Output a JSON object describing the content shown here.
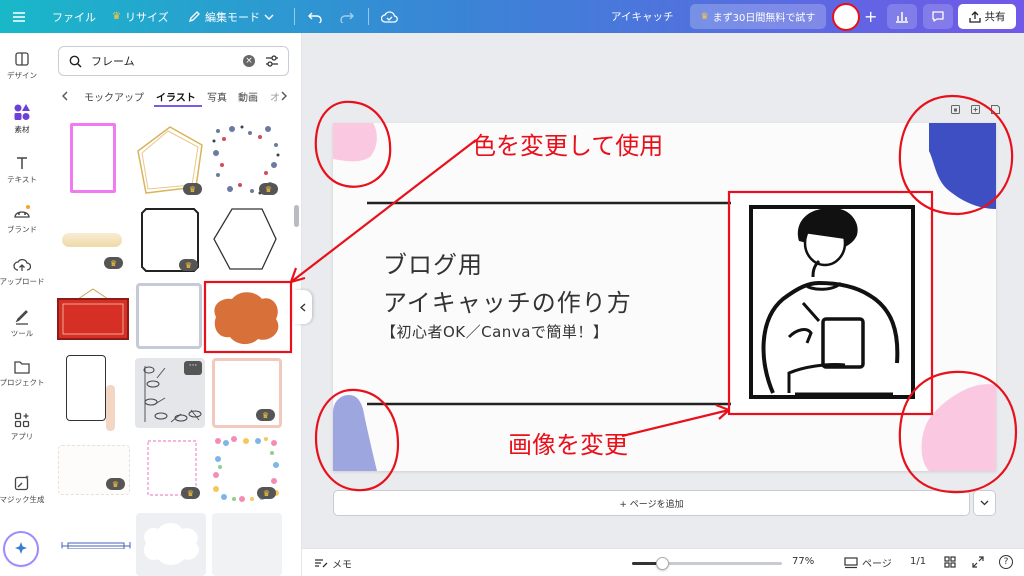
{
  "topbar": {
    "menu_icon": "hamburger-icon",
    "file": "ファイル",
    "resize": "リサイズ",
    "edit_mode": "編集モード",
    "doc_title": "アイキャッチ",
    "trial": "まず30日間無料で試す",
    "share": "共有",
    "accent": "#ffc93c"
  },
  "rail": [
    {
      "label": "デザイン",
      "icon": "design-icon"
    },
    {
      "label": "素材",
      "icon": "elements-icon"
    },
    {
      "label": "テキスト",
      "icon": "text-icon"
    },
    {
      "label": "ブランド",
      "icon": "brand-icon"
    },
    {
      "label": "アップロード",
      "icon": "upload-icon"
    },
    {
      "label": "ツール",
      "icon": "draw-icon"
    },
    {
      "label": "プロジェクト",
      "icon": "folder-icon"
    },
    {
      "label": "アプリ",
      "icon": "apps-icon"
    },
    {
      "label": "マジック生成",
      "icon": "magic-icon"
    }
  ],
  "panel": {
    "search_value": "フレーム",
    "tabs": [
      "モックアップ",
      "イラスト",
      "写真",
      "動画",
      "オ"
    ],
    "active_tab": "イラスト"
  },
  "canvas": {
    "line1": "ブログ用",
    "line2": "アイキャッチの作り方",
    "line3": "【初心者OK／Canvaで簡単！】",
    "pink": "#fbc8e2",
    "blue": "#3e4fc4",
    "lavender": "#9ea6e0"
  },
  "annotations": {
    "top": "色を変更して使用",
    "bottom": "画像を変更",
    "color": "#e8101a"
  },
  "add_page": "+ ページを追加",
  "bottombar": {
    "memo": "メモ",
    "zoom": "77%",
    "zoom_fraction": 0.2,
    "page_label": "ページ",
    "page_count": "1/1",
    "help": "?"
  }
}
